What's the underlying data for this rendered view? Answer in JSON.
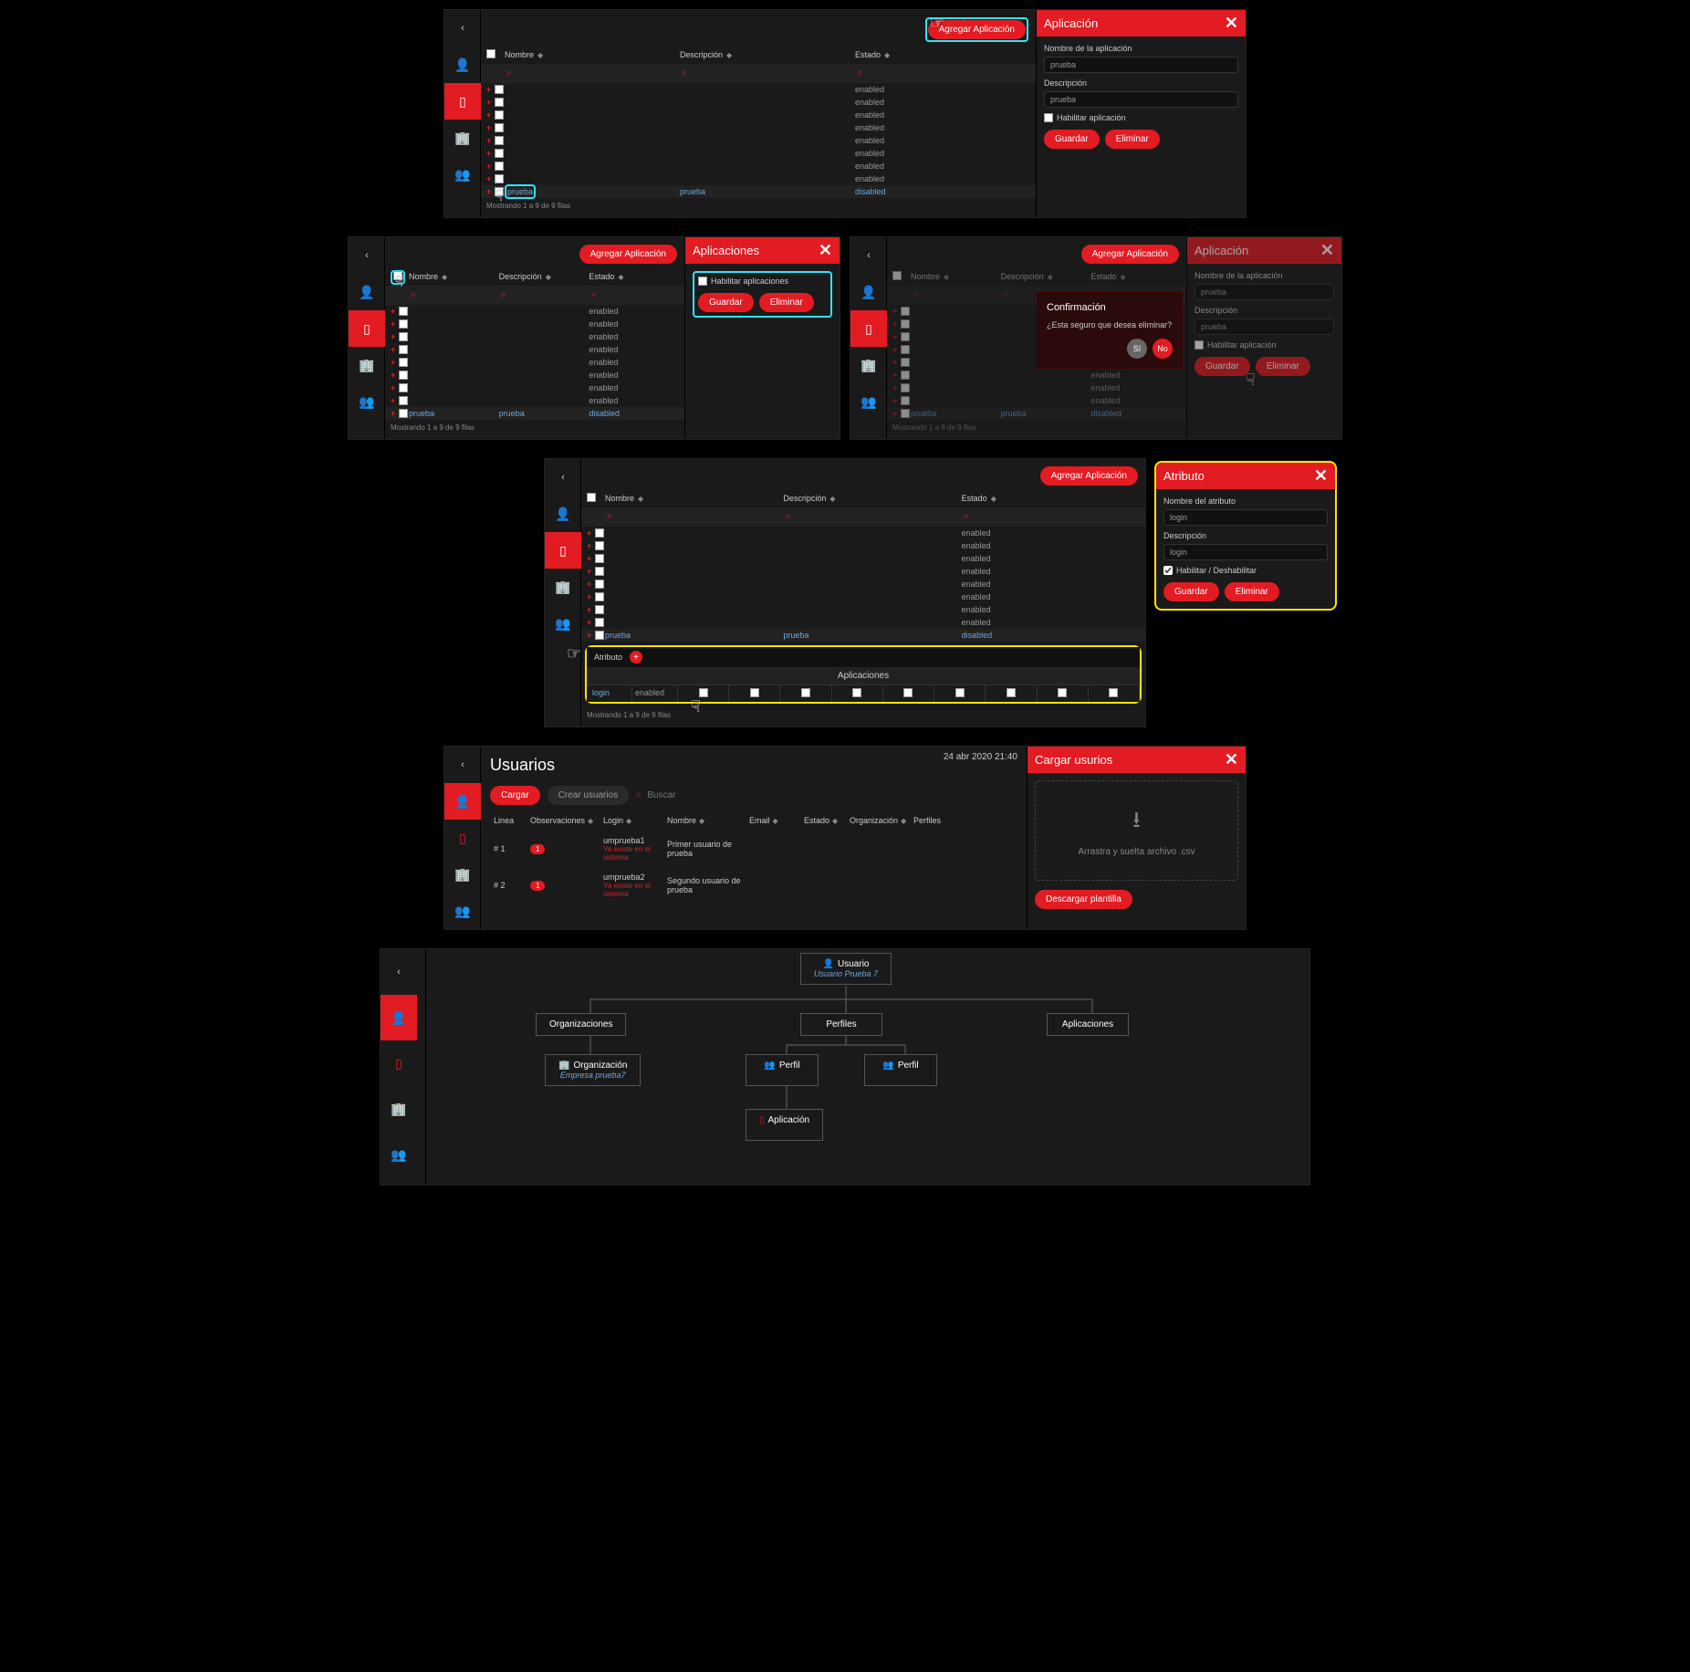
{
  "colors": {
    "accent": "#e31b23",
    "highlight_cyan": "#2ee5ff",
    "highlight_yellow": "#ffe400"
  },
  "sidebar_icons": [
    "‹",
    "user",
    "phone",
    "building",
    "group"
  ],
  "btn": {
    "agregar_aplicacion": "Agregar Aplicación",
    "guardar": "Guardar",
    "eliminar": "Eliminar",
    "si": "Sí",
    "no": "No",
    "cargar": "Cargar",
    "crear_usuarios": "Crear usuarios",
    "descargar_plantilla": "Descargar plantilla"
  },
  "table": {
    "cols": [
      "Nombre",
      "Descripción",
      "Estado"
    ],
    "footer1": "Mostrando 1 a 9 de 9 filas",
    "footer2": "Mostrando 1 a 9 de 9 filas",
    "rows": [
      {
        "n": "",
        "d": "",
        "e": "enabled"
      },
      {
        "n": "",
        "d": "",
        "e": "enabled"
      },
      {
        "n": "",
        "d": "",
        "e": "enabled"
      },
      {
        "n": "",
        "d": "",
        "e": "enabled"
      },
      {
        "n": "",
        "d": "",
        "e": "enabled"
      },
      {
        "n": "",
        "d": "",
        "e": "enabled"
      },
      {
        "n": "",
        "d": "",
        "e": "enabled"
      },
      {
        "n": "",
        "d": "",
        "e": "enabled"
      },
      {
        "n": "prueba",
        "d": "prueba",
        "e": "disabled",
        "sel": true
      }
    ]
  },
  "panel1": {
    "title": "Aplicación",
    "label_nombre": "Nombre de la aplicación",
    "val_nombre": "prueba",
    "label_desc": "Descripción",
    "val_desc": "prueba",
    "check": "Habilitar aplicación"
  },
  "panel2": {
    "title": "Aplicaciones",
    "check": "Habilitar aplicaciones"
  },
  "panel3": {
    "title": "Aplicación",
    "label_nombre": "Nombre de la aplicación",
    "val_nombre": "prueba",
    "label_desc": "Descripción",
    "val_desc": "prueba",
    "check": "Habilitar aplicación"
  },
  "confirm": {
    "title": "Confirmación",
    "text": "¿Esta seguro que desea eliminar?"
  },
  "panel4": {
    "title": "Atributo",
    "label_nombre": "Nombre del atributo",
    "val_nombre": "login",
    "label_desc": "Descripción",
    "val_desc": "login",
    "check": "Habilitar / Deshabilitar"
  },
  "attr_bar": {
    "label": "Atributo"
  },
  "apps_sub": {
    "header": "Aplicaciones",
    "row": {
      "name": "login",
      "state": "enabled"
    }
  },
  "usuarios": {
    "title": "Usuarios",
    "timestamp": "24 abr 2020 21:40",
    "search_placeholder": "Buscar",
    "cols": [
      "Linea",
      "Observaciones",
      "Login",
      "Nombre",
      "Email",
      "Estado",
      "Organización",
      "Perfiles"
    ],
    "rows": [
      {
        "linea": "# 1",
        "obs": "1",
        "login": "umprueba1",
        "err": "Ya existe en el sistema",
        "nombre": "Primer usuario de prueba"
      },
      {
        "linea": "# 2",
        "obs": "1",
        "login": "umprueba2",
        "err": "Ya existe en el sistema",
        "nombre": "Segundo usuario de prueba"
      }
    ],
    "panel_title": "Cargar usurios",
    "dropzone": "Arrastra y suelta archivo .csv"
  },
  "tree": {
    "root": {
      "label": "Usuario",
      "sub": "Usuario Prueba 7"
    },
    "orgs": {
      "label": "Organizaciones"
    },
    "org": {
      "label": "Organización",
      "sub": "Empresa prueba7"
    },
    "perfiles": {
      "label": "Perfiles"
    },
    "perfil": {
      "label": "Perfil"
    },
    "apps": {
      "label": "Aplicaciones"
    },
    "app": {
      "label": "Aplicación"
    }
  }
}
